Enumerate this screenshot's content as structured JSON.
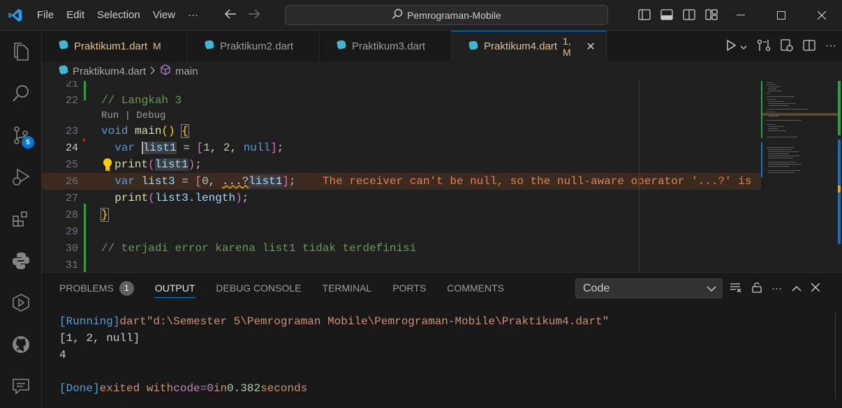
{
  "window": {
    "search_text": "Pemrograman-Mobile",
    "menu": [
      "File",
      "Edit",
      "Selection",
      "View",
      "···"
    ]
  },
  "activity_bar": {
    "source_control_badge": "5"
  },
  "tabs": [
    {
      "label": "Praktikum1.dart",
      "status": "M"
    },
    {
      "label": "Praktikum2.dart",
      "status": ""
    },
    {
      "label": "Praktikum3.dart",
      "status": ""
    },
    {
      "label": "Praktikum4.dart",
      "status": "1, M"
    }
  ],
  "breadcrumb": {
    "file": "Praktikum4.dart",
    "symbol": "main"
  },
  "editor": {
    "codelens": "Run | Debug",
    "lines": [
      {
        "n": "21",
        "text": ""
      },
      {
        "n": "22",
        "text": "// Langkah 3"
      },
      {
        "n": "23",
        "text": "void main() {"
      },
      {
        "n": "24",
        "text": "  var list1 = [1, 2, null];"
      },
      {
        "n": "25",
        "text": "  print(list1);"
      },
      {
        "n": "26",
        "text": "  var list3 = [0, ...?list1];"
      },
      {
        "n": "27",
        "text": "  print(list3.length);"
      },
      {
        "n": "28",
        "text": "}"
      },
      {
        "n": "29",
        "text": ""
      },
      {
        "n": "30",
        "text": "// terjadi error karena list1 tidak terdefinisi"
      },
      {
        "n": "31",
        "text": ""
      }
    ],
    "inline_error": "The receiver can't be null, so the null-aware operator '...?' is"
  },
  "panel": {
    "tabs": [
      "PROBLEMS",
      "OUTPUT",
      "DEBUG CONSOLE",
      "TERMINAL",
      "PORTS",
      "COMMENTS"
    ],
    "problems_count": "1",
    "output_channel": "Code",
    "output": {
      "running_tag": "[Running]",
      "running_cmd": "dart",
      "running_path": "\"d:\\Semester 5\\Pemrograman Mobile\\Pemrograman-Mobile\\Praktikum4.dart\"",
      "line2": "[1, 2, null]",
      "line3": "4",
      "done_tag": "[Done]",
      "done_text1": "exited with",
      "done_code": "code=0",
      "done_text2": "in",
      "done_time": "0.382",
      "done_text3": "seconds"
    }
  },
  "colors": {
    "accent": "#0078d4",
    "modified": "#e2c08d",
    "added_gutter": "#2ea043"
  }
}
